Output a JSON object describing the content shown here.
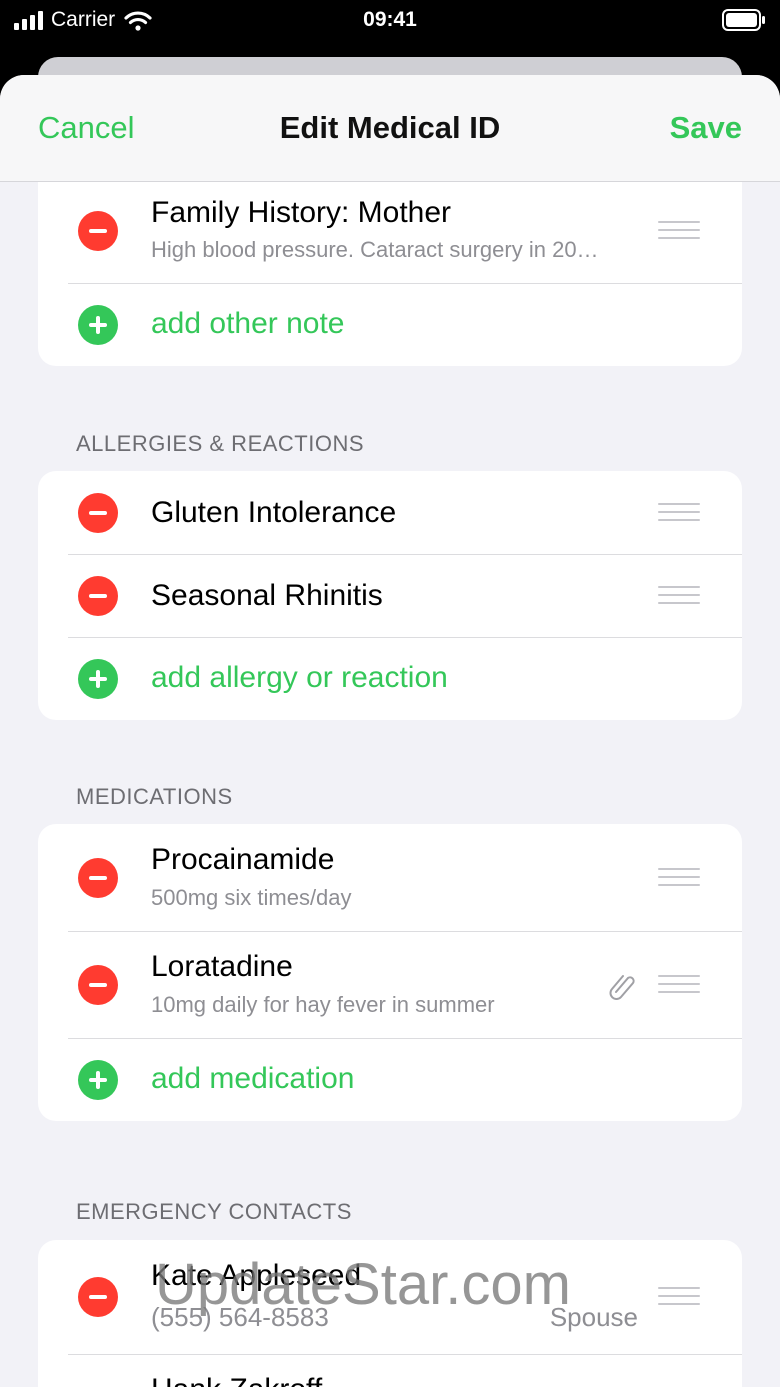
{
  "status_bar": {
    "carrier": "Carrier",
    "time": "09:41"
  },
  "nav": {
    "cancel": "Cancel",
    "title": "Edit Medical ID",
    "save": "Save"
  },
  "notes": {
    "item": {
      "title": "Family History: Mother",
      "detail": "High blood pressure. Cataract surgery in 20…"
    },
    "add": "add other note"
  },
  "allergies": {
    "header": "ALLERGIES & REACTIONS",
    "items": [
      {
        "title": "Gluten Intolerance"
      },
      {
        "title": "Seasonal Rhinitis"
      }
    ],
    "add": "add allergy or reaction"
  },
  "medications": {
    "header": "MEDICATIONS",
    "items": [
      {
        "title": "Procainamide",
        "detail": "500mg six times/day"
      },
      {
        "title": "Loratadine",
        "detail": "10mg daily for hay fever in summer"
      }
    ],
    "add": "add medication"
  },
  "contacts": {
    "header": "EMERGENCY CONTACTS",
    "items": [
      {
        "name": "Kate Appleseed",
        "phone": "(555) 564-8583",
        "relation": "Spouse"
      },
      {
        "name": "Hank Zakroff"
      }
    ]
  },
  "watermark": "UpdateStar.com",
  "colors": {
    "accent": "#34c759",
    "destructive": "#ff3b30",
    "background": "#f2f2f7"
  }
}
